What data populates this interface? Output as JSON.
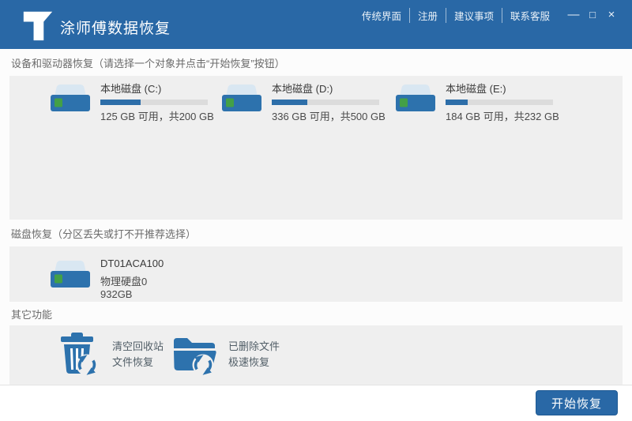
{
  "header": {
    "app_title": "涂师傅数据恢复",
    "nav_links": {
      "classic_ui": "传统界面",
      "register": "注册",
      "suggestions": "建议事项",
      "contact_support": "联系客服"
    },
    "window_controls": {
      "minimize": "—",
      "maximize": "□",
      "close": "×"
    }
  },
  "sections": {
    "devices": {
      "title": "设备和驱动器恢复（请选择一个对象并点击“开始恢复”按钮）",
      "drives": [
        {
          "name": "本地磁盘 (C:)",
          "capacity": "125 GB 可用，共200 GB",
          "used_percent": 37.5
        },
        {
          "name": "本地磁盘 (D:)",
          "capacity": "336 GB 可用，共500 GB",
          "used_percent": 32.8
        },
        {
          "name": "本地磁盘 (E:)",
          "capacity": "184 GB 可用，共232 GB",
          "used_percent": 20.7
        }
      ]
    },
    "disk_recovery": {
      "title": "磁盘恢复（分区丢失或打不开推荐选择）",
      "disk": {
        "model": "DT01ACA100",
        "detail": "物理硬盘0 932GB"
      }
    },
    "other": {
      "title": "其它功能",
      "features": [
        {
          "line1": "清空回收站",
          "line2": "文件恢复"
        },
        {
          "line1": "已删除文件",
          "line2": "极速恢复"
        }
      ]
    }
  },
  "footer": {
    "start_button": "开始恢复"
  },
  "colors": {
    "header_blue": "#2968a6",
    "icon_blue": "#2d72ad",
    "disk_lid": "#d9e7f2",
    "led_green": "#43a047",
    "panel_gray": "#efefef",
    "bar_fill": "#2d6ea9",
    "bar_track": "#dcdcdc"
  }
}
